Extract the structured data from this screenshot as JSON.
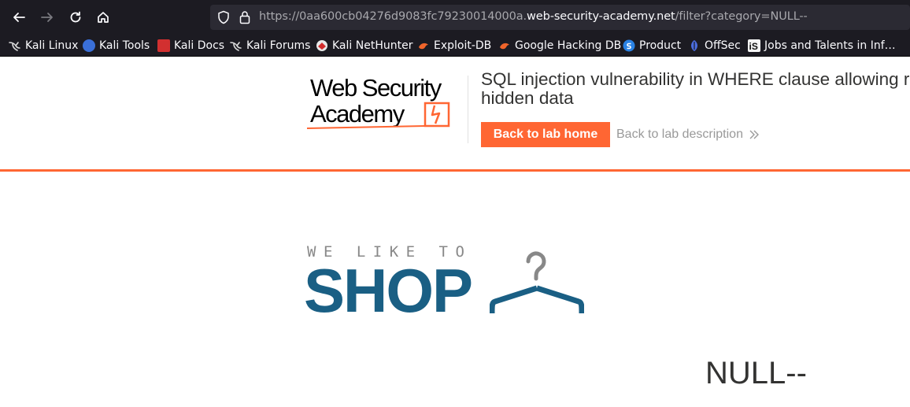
{
  "browser": {
    "url_prefix": "https://0aa600cb04276d9083fc79230014000a.",
    "url_domain": "web-security-academy.net",
    "url_path": "/filter?category=NULL--",
    "icons": [
      "back-icon",
      "forward-icon",
      "reload-icon",
      "home-icon",
      "shield-icon",
      "lock-icon"
    ]
  },
  "bookmarks": [
    {
      "label": "Kali Linux",
      "icon": "kali-dragon-icon"
    },
    {
      "label": "Kali Tools",
      "icon": "kali-tools-icon"
    },
    {
      "label": "Kali Docs",
      "icon": "kali-docs-icon"
    },
    {
      "label": "Kali Forums",
      "icon": "kali-dragon-icon"
    },
    {
      "label": "Kali NetHunter",
      "icon": "nethunter-icon"
    },
    {
      "label": "Exploit-DB",
      "icon": "exploit-db-icon"
    },
    {
      "label": "Google Hacking DB",
      "icon": "ghdb-icon"
    },
    {
      "label": "Product",
      "icon": "product-icon"
    },
    {
      "label": "OffSec",
      "icon": "offsec-icon"
    },
    {
      "label": "Jobs and Talents in Inf…",
      "icon": "is-icon"
    }
  ],
  "lab": {
    "logo_line1": "Web Security",
    "logo_line2": "Academy",
    "title_line1": "SQL injection vulnerability in WHERE clause allowing retrieval of",
    "title_line2": "hidden data",
    "back_home_label": "Back to lab home",
    "back_description_label": "Back to lab description",
    "accent_color": "#ff6633"
  },
  "shop": {
    "tagline": "WE LIKE TO",
    "word": "SHOP",
    "brand_color": "#1a5f84"
  },
  "category": {
    "heading": "NULL--"
  }
}
